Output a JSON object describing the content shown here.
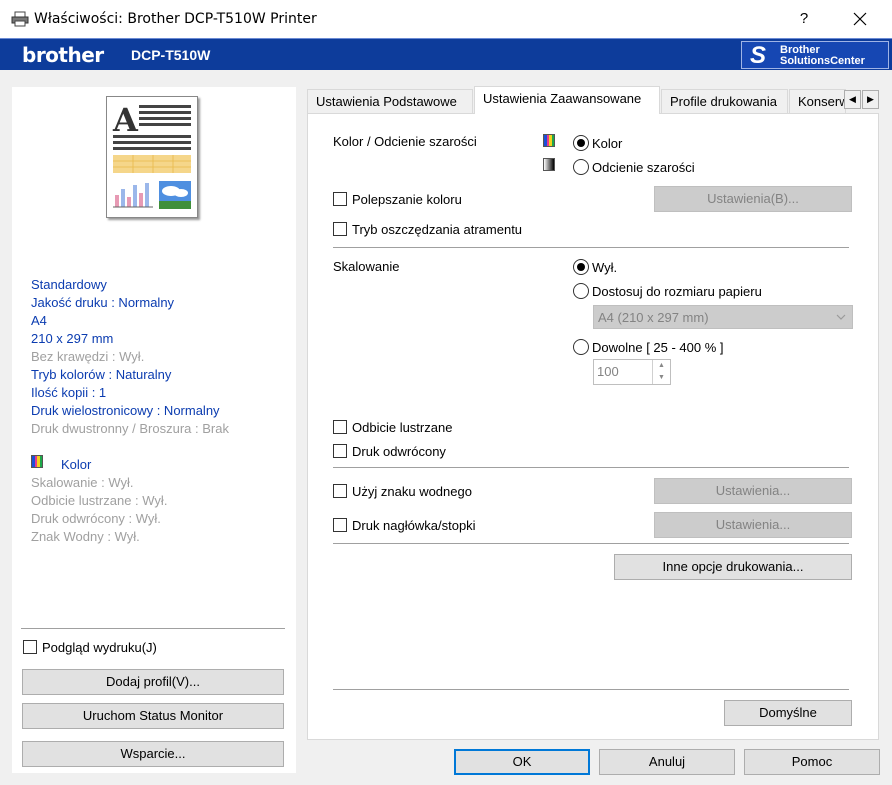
{
  "window": {
    "title": "Właściwości: Brother DCP-T510W Printer",
    "help_label": "?",
    "close_label": "×"
  },
  "banner": {
    "brand": "brother",
    "model": "DCP-T510W",
    "solutions_line1": "Brother",
    "solutions_line2": "SolutionsCenter"
  },
  "summary": {
    "items": [
      {
        "text": "Standardowy",
        "state": "on"
      },
      {
        "text": "Jakość druku : Normalny",
        "state": "on"
      },
      {
        "text": "A4",
        "state": "on"
      },
      {
        "text": "210 x 297 mm",
        "state": "on"
      },
      {
        "text": "Bez krawędzi : Wył.",
        "state": "off"
      },
      {
        "text": "Tryb kolorów : Naturalny",
        "state": "on"
      },
      {
        "text": "Ilość kopii : 1",
        "state": "on"
      },
      {
        "text": "Druk wielostronicowy : Normalny",
        "state": "on"
      },
      {
        "text": "Druk dwustronny / Broszura : Brak",
        "state": "off"
      }
    ],
    "color_label": "Kolor",
    "items2": [
      {
        "text": "Skalowanie : Wył.",
        "state": "off"
      },
      {
        "text": "Odbicie lustrzane : Wył.",
        "state": "off"
      },
      {
        "text": "Druk odwrócony : Wył.",
        "state": "off"
      },
      {
        "text": "Znak Wodny : Wył.",
        "state": "off"
      }
    ]
  },
  "left_controls": {
    "preview_checkbox": "Podgląd wydruku(J)",
    "add_profile": "Dodaj profil(V)...",
    "status_monitor": "Uruchom Status Monitor",
    "support": "Wsparcie..."
  },
  "tabs": [
    {
      "label": "Ustawienia Podstawowe",
      "active": false
    },
    {
      "label": "Ustawienia Zaawansowane",
      "active": true
    },
    {
      "label": "Profile drukowania",
      "active": false
    },
    {
      "label": "Konserwacja",
      "active": false
    }
  ],
  "tab_scroll": {
    "left": "◀",
    "right": "▶"
  },
  "advanced": {
    "color_section_label": "Kolor / Odcienie szarości",
    "color_option": "Kolor",
    "gray_option": "Odcienie szarości",
    "color_selected": "Kolor",
    "enhance_color": "Polepszanie koloru",
    "enhance_settings": "Ustawienia(B)...",
    "ink_save": "Tryb oszczędzania atramentu",
    "scaling_label": "Skalowanie",
    "scaling_off": "Wył.",
    "scaling_fit": "Dostosuj do rozmiaru papieru",
    "paper_size": "A4 (210 x 297 mm)",
    "scaling_custom": "Dowolne [ 25 - 400 % ]",
    "scaling_value": "100",
    "mirror": "Odbicie lustrzane",
    "reverse": "Druk odwrócony",
    "watermark": "Użyj znaku wodnego",
    "watermark_settings": "Ustawienia...",
    "header_footer": "Druk nagłówka/stopki",
    "header_footer_settings": "Ustawienia...",
    "other_options": "Inne opcje drukowania...",
    "defaults": "Domyślne"
  },
  "footer": {
    "ok": "OK",
    "cancel": "Anuluj",
    "help": "Pomoc"
  },
  "colors": {
    "banner_blue": "#0d3c9b",
    "summary_blue": "#0b3cb0",
    "summary_gray": "#a0a0a0",
    "focus_blue": "#0078d7"
  }
}
